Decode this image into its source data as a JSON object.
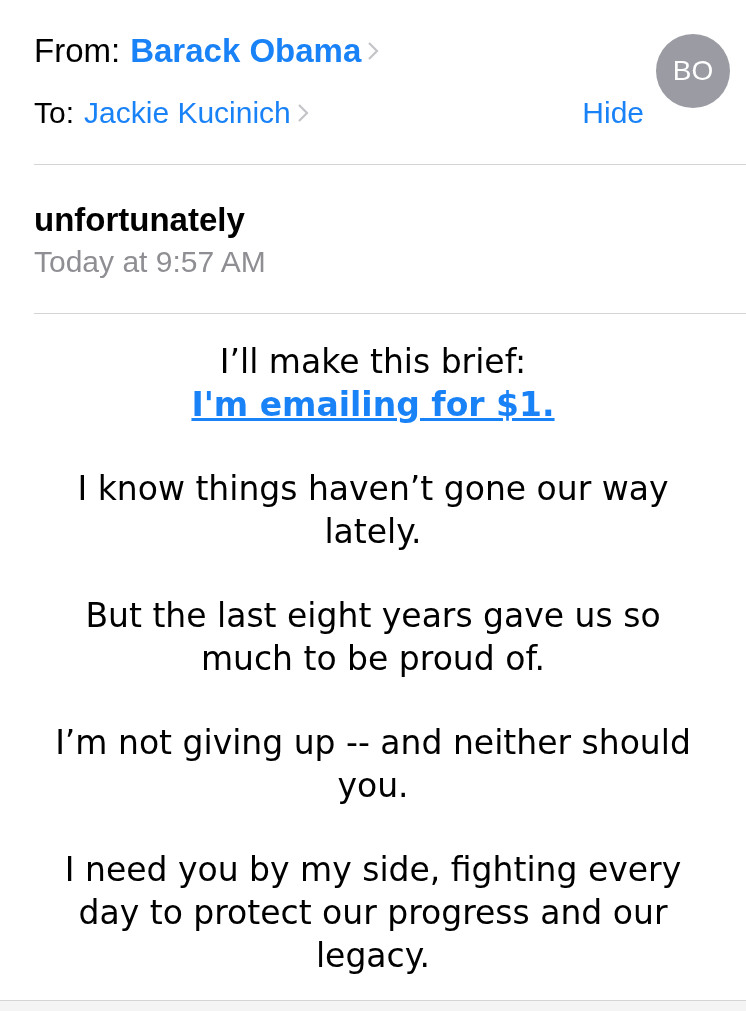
{
  "header": {
    "from_label": "From:",
    "from_name": "Barack Obama",
    "to_label": "To:",
    "to_name": "Jackie Kucinich",
    "hide": "Hide",
    "avatar_initials": "BO"
  },
  "subject": "unfortunately",
  "date": "Today at 9:57 AM",
  "body": [
    {
      "kind": "lead",
      "text": "I’ll make this brief:",
      "link": "I'm emailing for $1."
    },
    {
      "kind": "text",
      "text": "I know things haven’t gone our way lately."
    },
    {
      "kind": "text",
      "text": "But the last eight years gave us so much to be proud of."
    },
    {
      "kind": "text",
      "text": "I’m not giving up -- and neither should you."
    },
    {
      "kind": "text",
      "text": "I need you by my side, fighting every day to protect our progress and our legacy."
    }
  ]
}
